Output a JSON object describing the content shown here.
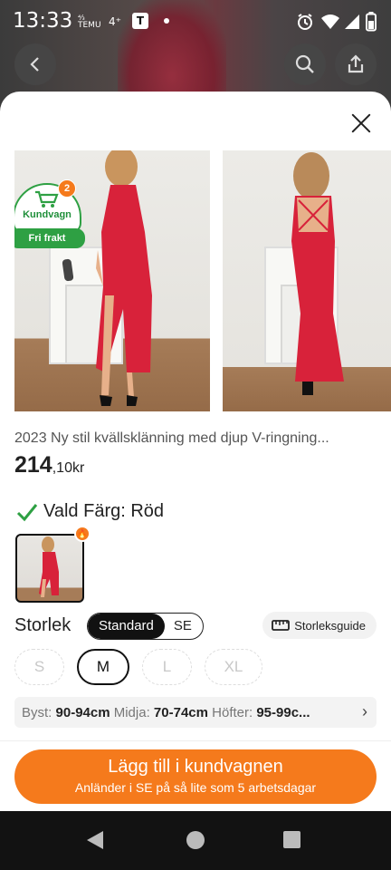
{
  "status_bar": {
    "time": "13:33",
    "icons": [
      "temu-app-icon",
      "4g-icon",
      "t-app-icon",
      "dot-icon",
      "alarm-icon",
      "wifi-icon",
      "signal-icon",
      "battery-icon"
    ],
    "temu_text": "TEMU",
    "network": "4⁺",
    "t_label": "T"
  },
  "background_page": {
    "back_icon": "chevron-left-icon",
    "search_icon": "search-icon",
    "share_icon": "share-icon"
  },
  "sheet": {
    "close_icon": "close-icon",
    "cart_badge": {
      "label": "Kundvagn",
      "count": "2",
      "free_shipping": "Fri frakt"
    },
    "product": {
      "title": "2023 Ny stil kvällsklänning med djup V-ringning...",
      "price_main": "214",
      "price_rest": ",10kr"
    },
    "color": {
      "label": "Vald Färg: Röd",
      "selected": "Röd"
    },
    "size": {
      "label": "Storlek",
      "standards": [
        "Standard",
        "SE"
      ],
      "selected_standard": "Standard",
      "guide_label": "Storleksguide",
      "options": [
        {
          "label": "S",
          "state": "unavailable"
        },
        {
          "label": "M",
          "state": "selected"
        },
        {
          "label": "L",
          "state": "unavailable"
        },
        {
          "label": "XL",
          "state": "unavailable"
        }
      ]
    },
    "measurements": {
      "bust_label": "Byst:",
      "bust_value": "90-94cm",
      "waist_label": "Midja:",
      "waist_value": "70-74cm",
      "hips_label": "Höfter:",
      "hips_value": "95-99c..."
    },
    "cta": {
      "line1": "Lägg till i kundvagnen",
      "line2": "Anländer i SE på så lite som 5 arbetsdagar"
    }
  },
  "colors": {
    "accent": "#f57a1c",
    "green": "#2ea043",
    "dress": "#d8223a"
  }
}
